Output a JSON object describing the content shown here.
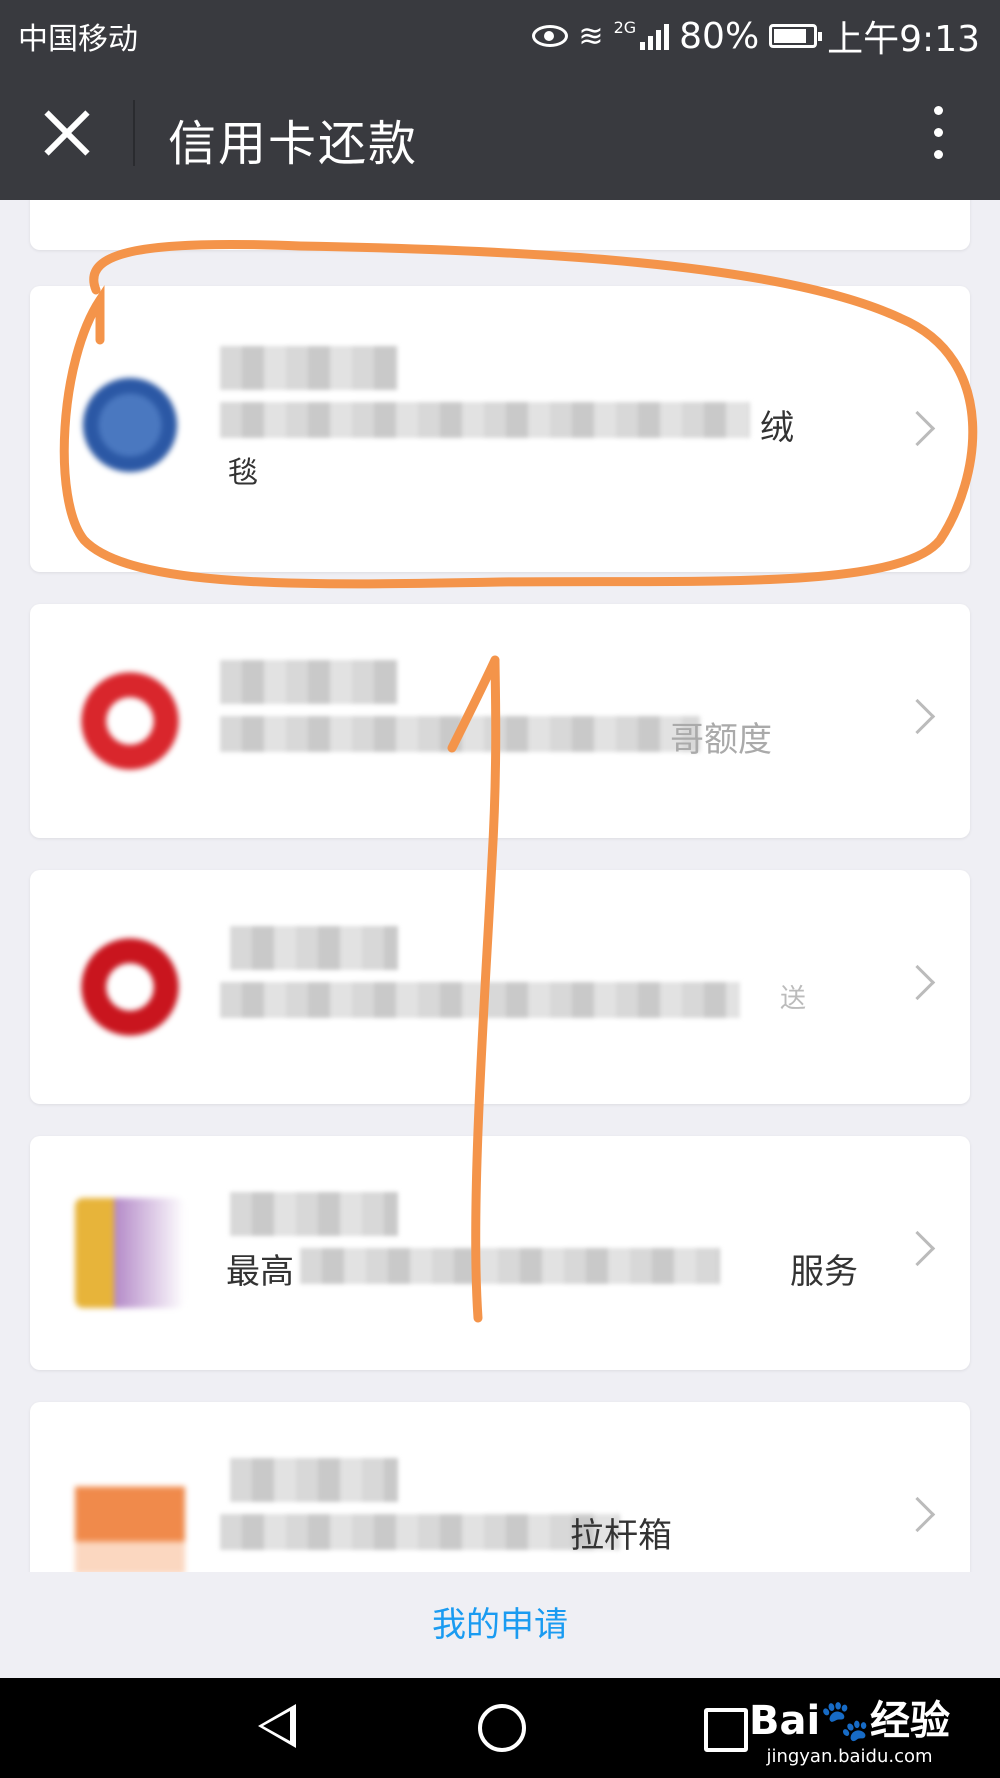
{
  "status_bar": {
    "carrier": "中国移动",
    "network": "2G",
    "battery": "80%",
    "time": "上午9:13"
  },
  "title_bar": {
    "title": "信用卡还款"
  },
  "list": {
    "items": [
      {
        "desc_end": "绒",
        "desc_line2": "毯"
      },
      {
        "desc_end": "哥额度"
      },
      {
        "desc_end": "送"
      },
      {
        "desc_start": "最高",
        "desc_end": "服务"
      },
      {
        "desc_end": "拉杆箱"
      }
    ]
  },
  "footer": {
    "link_label": "我的申请"
  },
  "watermark": {
    "brand": "Bai🐾经验",
    "url": "jingyan.baidu.com"
  },
  "colors": {
    "bar_bg": "#393a3f",
    "page_bg": "#efeff4",
    "link": "#1a9bf1",
    "annotation": "#f4944a"
  }
}
